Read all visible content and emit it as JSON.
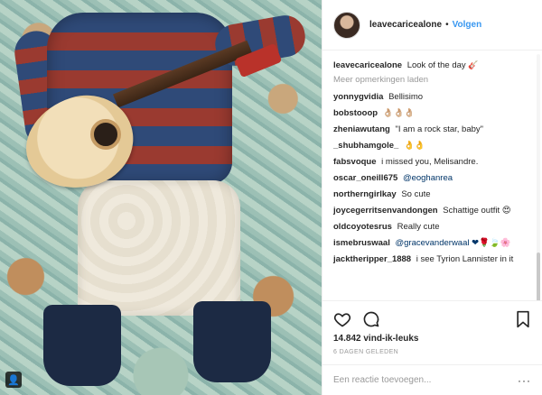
{
  "post": {
    "username": "leavecaricealone",
    "follow_label": "Volgen",
    "dot": "•",
    "caption": "Look of the day",
    "load_more": "Meer opmerkingen laden",
    "likes": "14.842 vind-ik-leuks",
    "time": "6 DAGEN GELEDEN",
    "add_comment_placeholder": "Een reactie toevoegen...",
    "more_options": "···"
  },
  "comments": [
    {
      "user": "yonnygvidia",
      "text": "Bellisimo"
    },
    {
      "user": "bobstooop",
      "text": "👌🏼👌🏼👌🏼"
    },
    {
      "user": "zheniawutang",
      "text": "\"I am a rock star, baby\""
    },
    {
      "user": "_shubhamgole_",
      "text": "👌👌"
    },
    {
      "user": "fabsvoque",
      "text": "i missed you, Melisandre."
    },
    {
      "user": "oscar_oneill675",
      "text": "@eoghanrea"
    },
    {
      "user": "northerngirlkay",
      "text": "So cute"
    },
    {
      "user": "joycegerritsenvandongen",
      "text": "Schattige outfit 😍"
    },
    {
      "user": "oldcoyotesrus",
      "text": "Really cute"
    },
    {
      "user": "ismebruswaal",
      "text": "@gracevanderwaal ❤🌹🍃🌸"
    },
    {
      "user": "jacktheripper_1888",
      "text": "i see Tyrion Lannister in it"
    }
  ],
  "icons": {
    "like": "heart-icon",
    "comment": "comment-icon",
    "save": "bookmark-icon",
    "guitar": "guitar-emoji",
    "user_tag": "user-tag-icon"
  }
}
